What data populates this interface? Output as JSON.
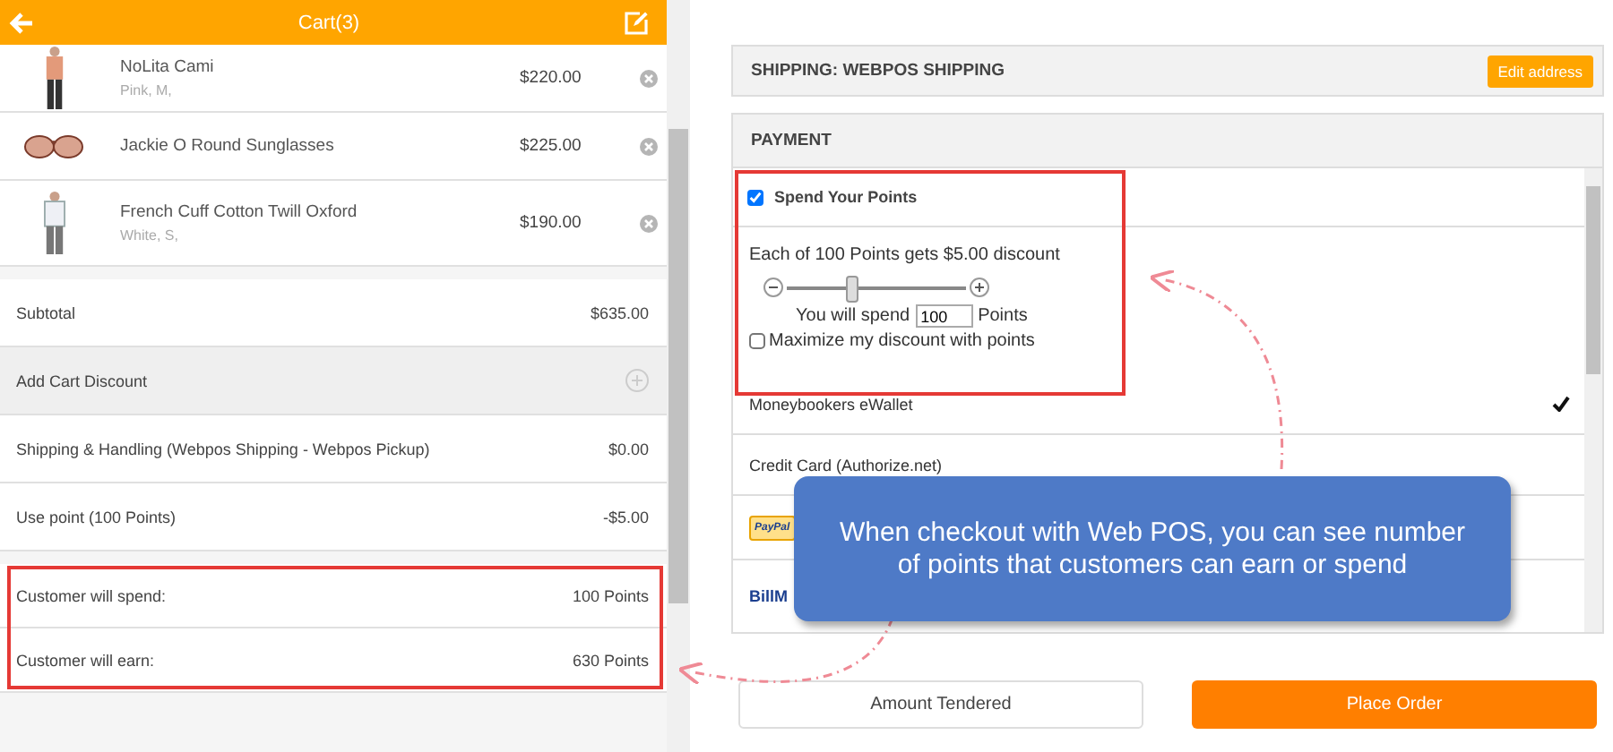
{
  "header": {
    "title": "Cart(3)"
  },
  "cart_items": [
    {
      "name": "NoLita Cami",
      "options": "Pink, M,",
      "price": "$220.00",
      "kind": "top"
    },
    {
      "name": "Jackie O Round Sunglasses",
      "price": "$225.00",
      "kind": "glasses"
    },
    {
      "name": "French Cuff Cotton Twill Oxford",
      "options": "White, S,",
      "price": "$190.00",
      "kind": "shirt"
    }
  ],
  "totals": [
    {
      "kind": "line",
      "label": "Subtotal",
      "value": "$635.00"
    },
    {
      "kind": "action",
      "label": "Add Cart Discount"
    },
    {
      "kind": "line",
      "label": "Shipping & Handling (Webpos Shipping - Webpos Pickup)",
      "value": "$0.00"
    },
    {
      "kind": "line",
      "label": "Use point (100 Points)",
      "value": "-$5.00"
    }
  ],
  "points_summary": [
    {
      "label": "Customer will spend:",
      "value": "100 Points"
    },
    {
      "label": "Customer will earn:",
      "value": "630 Points"
    }
  ],
  "shipping": {
    "title": "SHIPPING: WEBPOS SHIPPING",
    "button": "Edit address"
  },
  "payment": {
    "title": "PAYMENT",
    "spend_points": {
      "label": "Spend Your Points",
      "checked": true,
      "rule": "Each of 100 Points gets $5.00 discount",
      "level": 0.35,
      "spend_prefix": "You will spend",
      "spend_value": "100",
      "spend_suffix": "Points",
      "maximize": {
        "label": "Maximize my discount with points",
        "checked": false
      }
    },
    "methods": [
      {
        "kind": "text",
        "label": "Moneybookers eWallet",
        "selected": true
      },
      {
        "kind": "text",
        "label": "Credit Card (Authorize.net)",
        "selected": false
      },
      {
        "kind": "paypal",
        "label": "PayPal",
        "selected": false
      },
      {
        "kind": "billme",
        "label": "BillM",
        "selected": false
      }
    ]
  },
  "buttons": [
    {
      "kind": "secondary",
      "label": "Amount Tendered"
    },
    {
      "kind": "primary",
      "label": "Place Order"
    }
  ],
  "callout": {
    "text": "When checkout with Web POS, you can see number of points that customers can earn or spend"
  }
}
